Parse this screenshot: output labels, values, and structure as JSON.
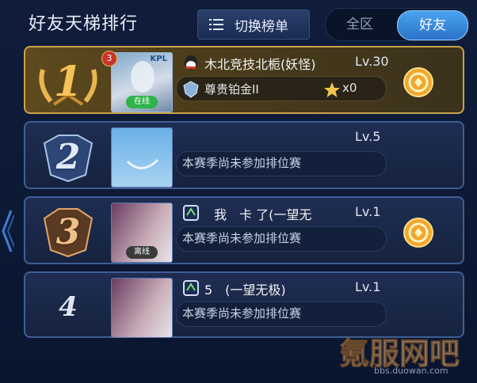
{
  "header": {
    "title": "好友天梯排行",
    "switch_label": "切换榜单",
    "tabs": [
      {
        "label": "全区",
        "active": false
      },
      {
        "label": "好友",
        "active": true
      }
    ]
  },
  "rows": [
    {
      "rank": "1",
      "avatar_badge": "3",
      "avatar_tag": "KPL",
      "status": "在线",
      "name": "木北竞技北栀(妖怪)",
      "level": "Lv.30",
      "rank_tier": "尊贵铂金II",
      "stars": "x0",
      "has_coin": true
    },
    {
      "rank": "2",
      "status": "",
      "name": "",
      "level": "Lv.5",
      "note": "本赛季尚未参加排位赛",
      "has_coin": false
    },
    {
      "rank": "3",
      "status": "离线",
      "name": "我　卡 了(一望无",
      "level": "Lv.1",
      "note": "本赛季尚未参加排位赛",
      "has_coin": true
    },
    {
      "rank": "4",
      "status": "",
      "name": "5　(一望无极)",
      "level": "Lv.1",
      "note": "本赛季尚未参加排位赛",
      "has_coin": false
    }
  ],
  "watermark": {
    "text": "氪服网吧",
    "url": "bbs.duowan.com"
  },
  "colors": {
    "accent": "#3b8fe0",
    "gold": "#d8a642",
    "online": "#2fb34a"
  }
}
